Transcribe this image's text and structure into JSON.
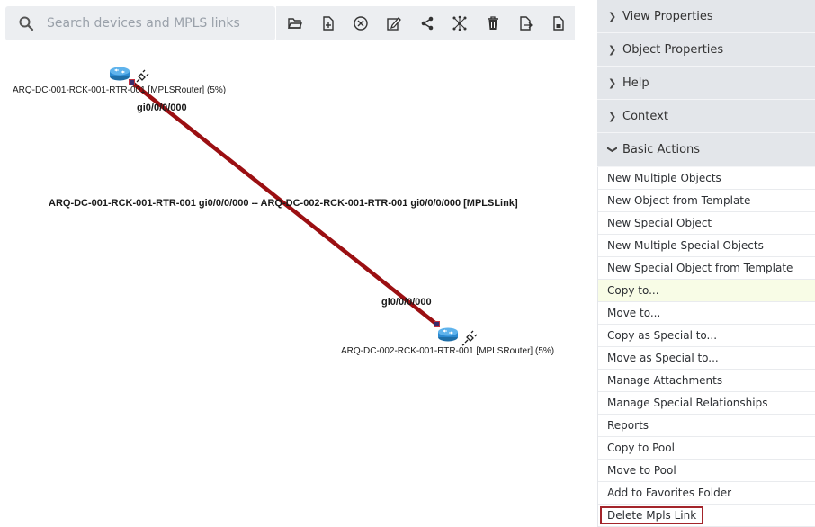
{
  "search": {
    "placeholder": "Search devices and MPLS links",
    "value": ""
  },
  "toolbar": {
    "buttons": [
      {
        "icon": "folder-open-icon"
      },
      {
        "icon": "new-file-icon"
      },
      {
        "icon": "close-circle-icon"
      },
      {
        "icon": "edit-icon"
      },
      {
        "icon": "share-icon"
      },
      {
        "icon": "network-hub-icon"
      },
      {
        "icon": "trash-icon"
      },
      {
        "icon": "file-export-icon"
      },
      {
        "icon": "file-report-icon"
      }
    ]
  },
  "canvas": {
    "link_color": "#9b0f12",
    "nodes": [
      {
        "label": "ARQ-DC-001-RCK-001-RTR-001 [MPLSRouter] (5%)",
        "icon": "router-icon"
      },
      {
        "label": "ARQ-DC-002-RCK-001-RTR-001 [MPLSRouter] (5%)",
        "icon": "router-icon"
      }
    ],
    "ports": [
      "gi0/0/0/000",
      "gi0/0/0/000"
    ],
    "link_label": "ARQ-DC-001-RCK-001-RTR-001 gi0/0/0/000 -- ARQ-DC-002-RCK-001-RTR-001 gi0/0/0/000 [MPLSLink]"
  },
  "panel": {
    "sections": [
      {
        "label": "View Properties",
        "expanded": false
      },
      {
        "label": "Object Properties",
        "expanded": false
      },
      {
        "label": "Help",
        "expanded": false
      },
      {
        "label": "Context",
        "expanded": false
      },
      {
        "label": "Basic Actions",
        "expanded": true
      }
    ],
    "actions": [
      "New Multiple Objects",
      "New Object from Template",
      "New Special Object",
      "New Multiple Special Objects",
      "New Special Object from Template",
      "Copy to...",
      "Move to...",
      "Copy as Special to...",
      "Move as Special to...",
      "Manage Attachments",
      "Manage Special Relationships",
      "Reports",
      "Copy to Pool",
      "Move to Pool",
      "Add to Favorites Folder",
      "Delete Mpls Link"
    ],
    "hovered_action": "Copy to...",
    "highlighted_action": "Delete Mpls Link"
  }
}
